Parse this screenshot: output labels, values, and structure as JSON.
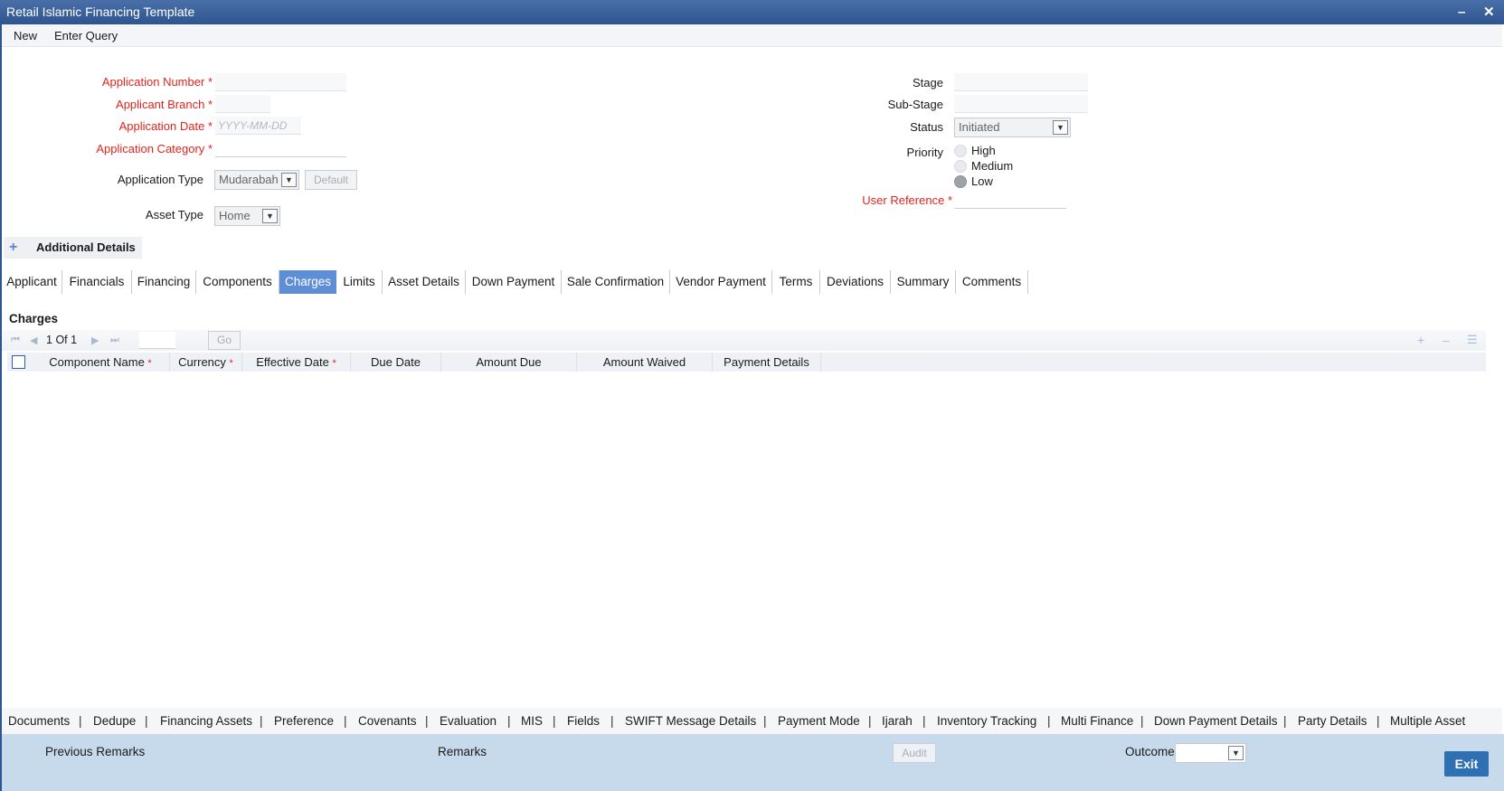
{
  "window": {
    "title": "Retail Islamic Financing Template",
    "minimize_glyph": "–",
    "close_glyph": "✕"
  },
  "menu": {
    "new": "New",
    "enter_query": "Enter Query"
  },
  "form_left": {
    "application_number_label": "Application Number",
    "applicant_branch_label": "Applicant Branch",
    "application_date_label": "Application Date",
    "application_date_placeholder": "YYYY-MM-DD",
    "application_category_label": "Application Category",
    "application_type_label": "Application Type",
    "application_type_value": "Mudarabah",
    "default_button": "Default",
    "asset_type_label": "Asset Type",
    "asset_type_value": "Home",
    "required_marker": "*"
  },
  "form_right": {
    "stage_label": "Stage",
    "sub_stage_label": "Sub-Stage",
    "status_label": "Status",
    "status_value": "Initiated",
    "priority_label": "Priority",
    "priority_options": [
      "High",
      "Medium",
      "Low"
    ],
    "priority_selected": "Low",
    "user_reference_label": "User Reference"
  },
  "additional_details": {
    "toggle": "+",
    "label": "Additional Details"
  },
  "tabs": [
    {
      "label": "Applicant"
    },
    {
      "label": "Financials"
    },
    {
      "label": "Financing"
    },
    {
      "label": "Components"
    },
    {
      "label": "Charges",
      "active": true
    },
    {
      "label": "Limits"
    },
    {
      "label": "Asset Details"
    },
    {
      "label": "Down Payment"
    },
    {
      "label": "Sale Confirmation"
    },
    {
      "label": "Vendor Payment"
    },
    {
      "label": "Terms"
    },
    {
      "label": "Deviations"
    },
    {
      "label": "Summary"
    },
    {
      "label": "Comments"
    }
  ],
  "charges": {
    "section_title": "Charges",
    "pager": {
      "current": "1",
      "of_label": "Of",
      "total": "1",
      "go_button": "Go"
    },
    "columns": [
      {
        "label": "Component Name",
        "required": true
      },
      {
        "label": "Currency",
        "required": true
      },
      {
        "label": "Effective Date",
        "required": true
      },
      {
        "label": "Due Date",
        "required": false
      },
      {
        "label": "Amount Due",
        "required": false
      },
      {
        "label": "Amount Waived",
        "required": false
      },
      {
        "label": "Payment Details",
        "required": false
      }
    ],
    "required_marker": "*",
    "rows": []
  },
  "bottom_links": [
    "Documents",
    "Dedupe",
    "Financing Assets",
    "Preference",
    "Covenants",
    "Evaluation",
    "MIS",
    "Fields",
    "SWIFT Message Details",
    "Payment Mode",
    "Ijarah",
    "Inventory Tracking",
    "Multi Finance",
    "Down Payment Details",
    "Party Details",
    "Multiple Asset"
  ],
  "footer": {
    "previous_remarks_label": "Previous Remarks",
    "remarks_label": "Remarks",
    "audit_button": "Audit",
    "outcome_label": "Outcome",
    "outcome_value": "",
    "exit_button": "Exit"
  },
  "colors": {
    "title_bar": "#2f5590",
    "active_tab": "#5e8fd6",
    "required_label": "#e0251b",
    "footer_bg": "#c7daec",
    "exit_button": "#2f6fb3"
  }
}
